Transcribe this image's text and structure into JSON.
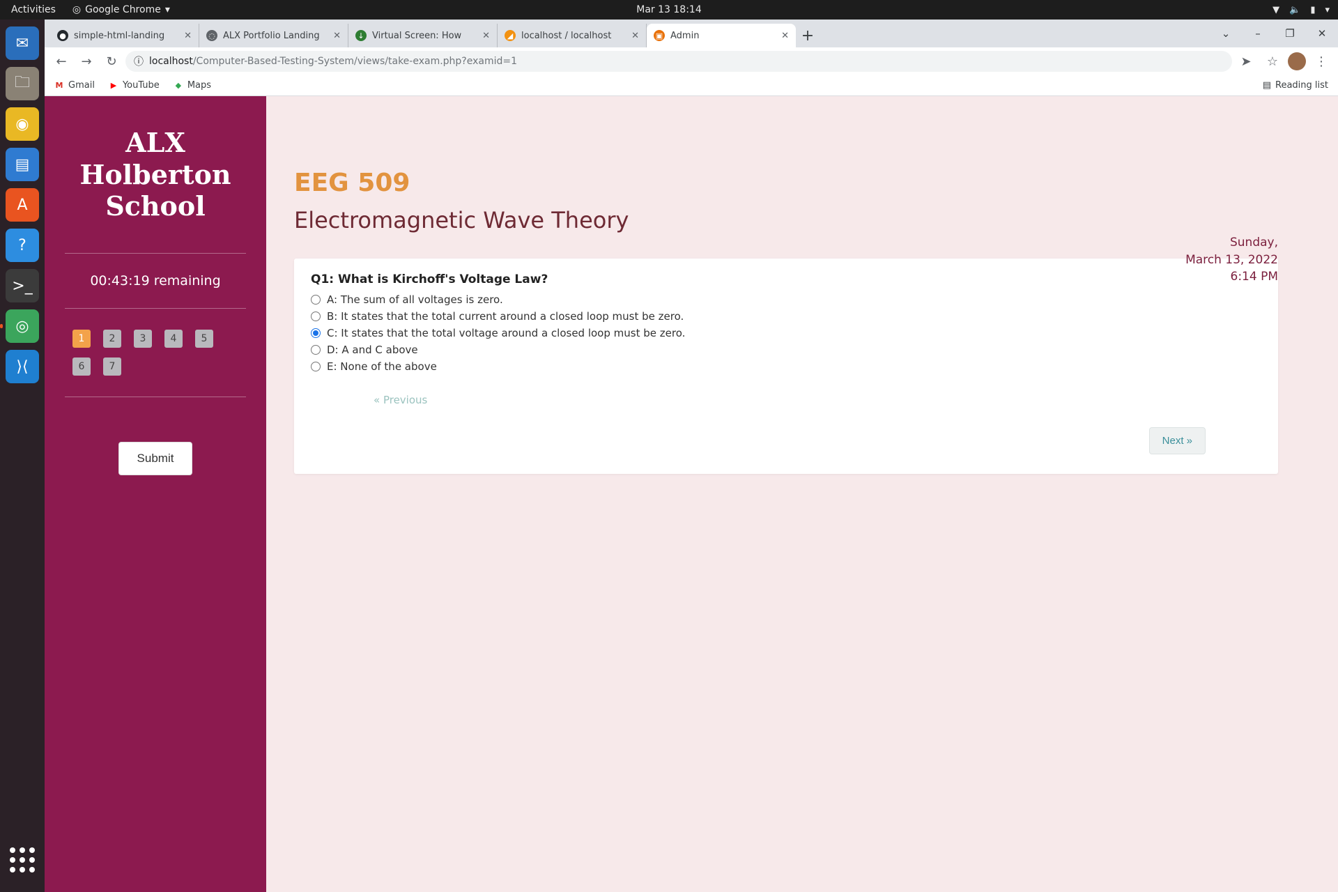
{
  "topbar": {
    "activities": "Activities",
    "app_name": "Google Chrome",
    "clock": "Mar 13  18:14"
  },
  "dock": {
    "items": [
      {
        "name": "thunderbird-icon",
        "glyph": "✉",
        "color": "#2a6ebb"
      },
      {
        "name": "files-icon",
        "glyph": "🗀",
        "color": "#8a8275"
      },
      {
        "name": "rhythmbox-icon",
        "glyph": "◉",
        "color": "#e9b824"
      },
      {
        "name": "writer-icon",
        "glyph": "▤",
        "color": "#2f7bd1"
      },
      {
        "name": "software-center-icon",
        "glyph": "A",
        "color": "#e95420"
      },
      {
        "name": "help-icon",
        "glyph": "?",
        "color": "#2d8de0"
      },
      {
        "name": "terminal-icon",
        "glyph": ">_",
        "color": "#3b3b3b"
      },
      {
        "name": "chrome-icon",
        "glyph": "◎",
        "color": "#3ba55c"
      },
      {
        "name": "vscode-icon",
        "glyph": "⟩⟨",
        "color": "#1f7fd0"
      }
    ]
  },
  "browser": {
    "tabs": [
      {
        "title": "simple-html-landing",
        "color": "#24292e",
        "glyph": "●"
      },
      {
        "title": "ALX Portfolio Landing",
        "color": "#5f6368",
        "glyph": "◌"
      },
      {
        "title": "Virtual Screen: How",
        "color": "#2e7d32",
        "glyph": "↓"
      },
      {
        "title": "localhost / localhost",
        "color": "#f29111",
        "glyph": "◢"
      },
      {
        "title": "Admin",
        "color": "#e8710a",
        "glyph": "▣"
      }
    ],
    "url_host": "localhost",
    "url_path": "/Computer-Based-Testing-System/views/take-exam.php?examid=1",
    "bookmarks": [
      {
        "label": "Gmail",
        "glyph": "M",
        "color": "#d93025"
      },
      {
        "label": "YouTube",
        "glyph": "▶",
        "color": "#ff0000"
      },
      {
        "label": "Maps",
        "glyph": "◆",
        "color": "#34a853"
      }
    ],
    "reading_list": "Reading list"
  },
  "exam": {
    "school_line1": "ALX",
    "school_line2": "Holberton",
    "school_line3": "School",
    "timer": "00:43:19 remaining",
    "question_numbers": [
      "1",
      "2",
      "3",
      "4",
      "5",
      "6",
      "7"
    ],
    "current_question": 1,
    "submit_label": "Submit",
    "course_code": "EEG 509",
    "course_name": "Electromagnetic Wave Theory",
    "date_line1": "Sunday,",
    "date_line2": "March 13, 2022",
    "date_line3": "6:14 PM",
    "question": "Q1: What is Kirchoff's Voltage Law?",
    "options": [
      "A: The sum of all voltages is zero.",
      "B: It states that the total current around a closed loop must be zero.",
      "C: It states that the total voltage around a closed loop must be zero.",
      "D: A and C above",
      "E: None of the above"
    ],
    "selected_option": 2,
    "prev_label": "« Previous",
    "next_label": "Next »"
  }
}
